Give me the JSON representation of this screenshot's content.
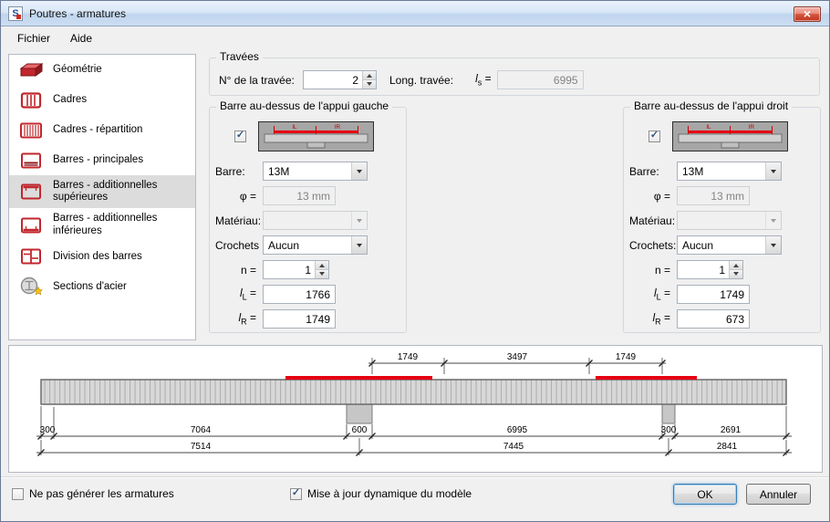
{
  "window": {
    "title": "Poutres - armatures",
    "icon_letter": "S"
  },
  "menu": {
    "file": "Fichier",
    "help": "Aide"
  },
  "icons": {
    "close": "×",
    "check": "✓"
  },
  "sym": {
    "eq": "=",
    "l": "l",
    "L": "L",
    "R": "R",
    "s": "s",
    "phi": "φ",
    "n": "n"
  },
  "sidebar": {
    "items": [
      {
        "label": "Géométrie"
      },
      {
        "label": "Cadres"
      },
      {
        "label": "Cadres - répartition"
      },
      {
        "label": "Barres - principales"
      },
      {
        "label": "Barres - additionnelles supérieures"
      },
      {
        "label": "Barres - additionnelles inférieures"
      },
      {
        "label": "Division des barres"
      },
      {
        "label": "Sections d'acier"
      }
    ]
  },
  "spans_group": {
    "title": "Travées",
    "span_no_label": "N° de la travée:",
    "span_no_value": "2",
    "span_len_label": "Long. travée:",
    "ls_value": "6995"
  },
  "field_labels": {
    "bar": "Barre:",
    "material": "Matériau:",
    "hooks_left": "Crochets",
    "hooks_right": "Crochets:"
  },
  "left_group": {
    "title": "Barre au-dessus de l'appui gauche",
    "bar_value": "13M",
    "phi_value": "13 mm",
    "material_value": "",
    "hooks_value": "Aucun",
    "n_value": "1",
    "lL_value": "1766",
    "lR_value": "1749"
  },
  "right_group": {
    "title": "Barre au-dessus de l'appui droit",
    "bar_value": "13M",
    "phi_value": "13 mm",
    "material_value": "",
    "hooks_value": "Aucun",
    "n_value": "1",
    "lL_value": "1749",
    "lR_value": "673"
  },
  "thumb": {
    "lL": "lL",
    "lR": "lR"
  },
  "drawing": {
    "top_dims": [
      "1749",
      "3497",
      "1749"
    ],
    "row1_dims": [
      "300",
      "7064",
      "600",
      "6995",
      "300",
      "2691"
    ],
    "row2_dims": [
      "7514",
      "7445",
      "2841"
    ]
  },
  "footer": {
    "no_generate_label": "Ne pas générer les armatures",
    "dynamic_update_label": "Mise à jour dynamique du modèle",
    "ok_label": "OK",
    "cancel_label": "Annuler"
  },
  "colors": {
    "rebar_red": "#e60012",
    "icon_red": "#c1272d",
    "titlebar_blue": "#c3d9f1",
    "selected_row_gray": "#dcdcdc"
  }
}
